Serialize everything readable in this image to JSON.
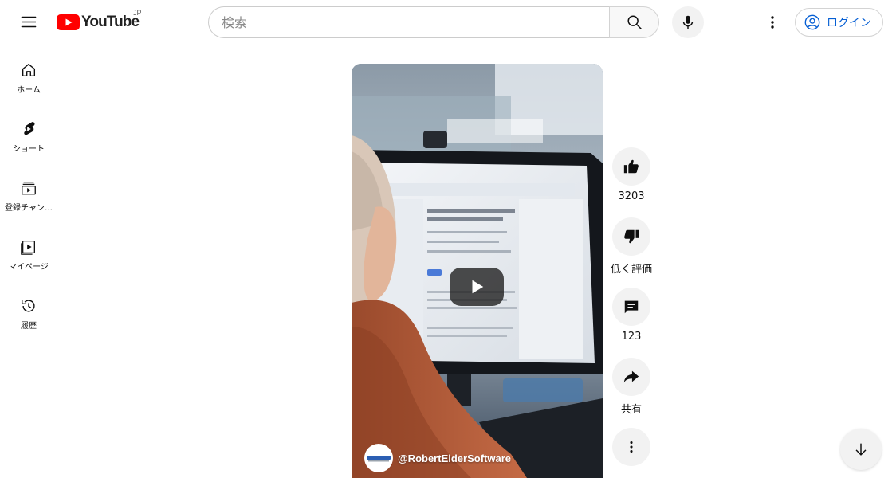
{
  "header": {
    "logo_text": "YouTube",
    "country_code": "JP",
    "search_placeholder": "検索",
    "login_label": "ログイン"
  },
  "sidebar": {
    "items": [
      {
        "label": "ホーム",
        "icon": "home-icon"
      },
      {
        "label": "ショート",
        "icon": "shorts-icon"
      },
      {
        "label": "登録チャン…",
        "icon": "subscriptions-icon"
      },
      {
        "label": "マイページ",
        "icon": "library-icon"
      },
      {
        "label": "履歴",
        "icon": "history-icon"
      }
    ]
  },
  "video": {
    "channel_handle": "@RobertElderSoftware"
  },
  "actions": {
    "like_count": "3203",
    "dislike_label": "低く評価",
    "comment_count": "123",
    "share_label": "共有"
  },
  "colors": {
    "brand_red": "#ff0000",
    "link_blue": "#065fd4",
    "button_bg": "#f2f2f2"
  }
}
